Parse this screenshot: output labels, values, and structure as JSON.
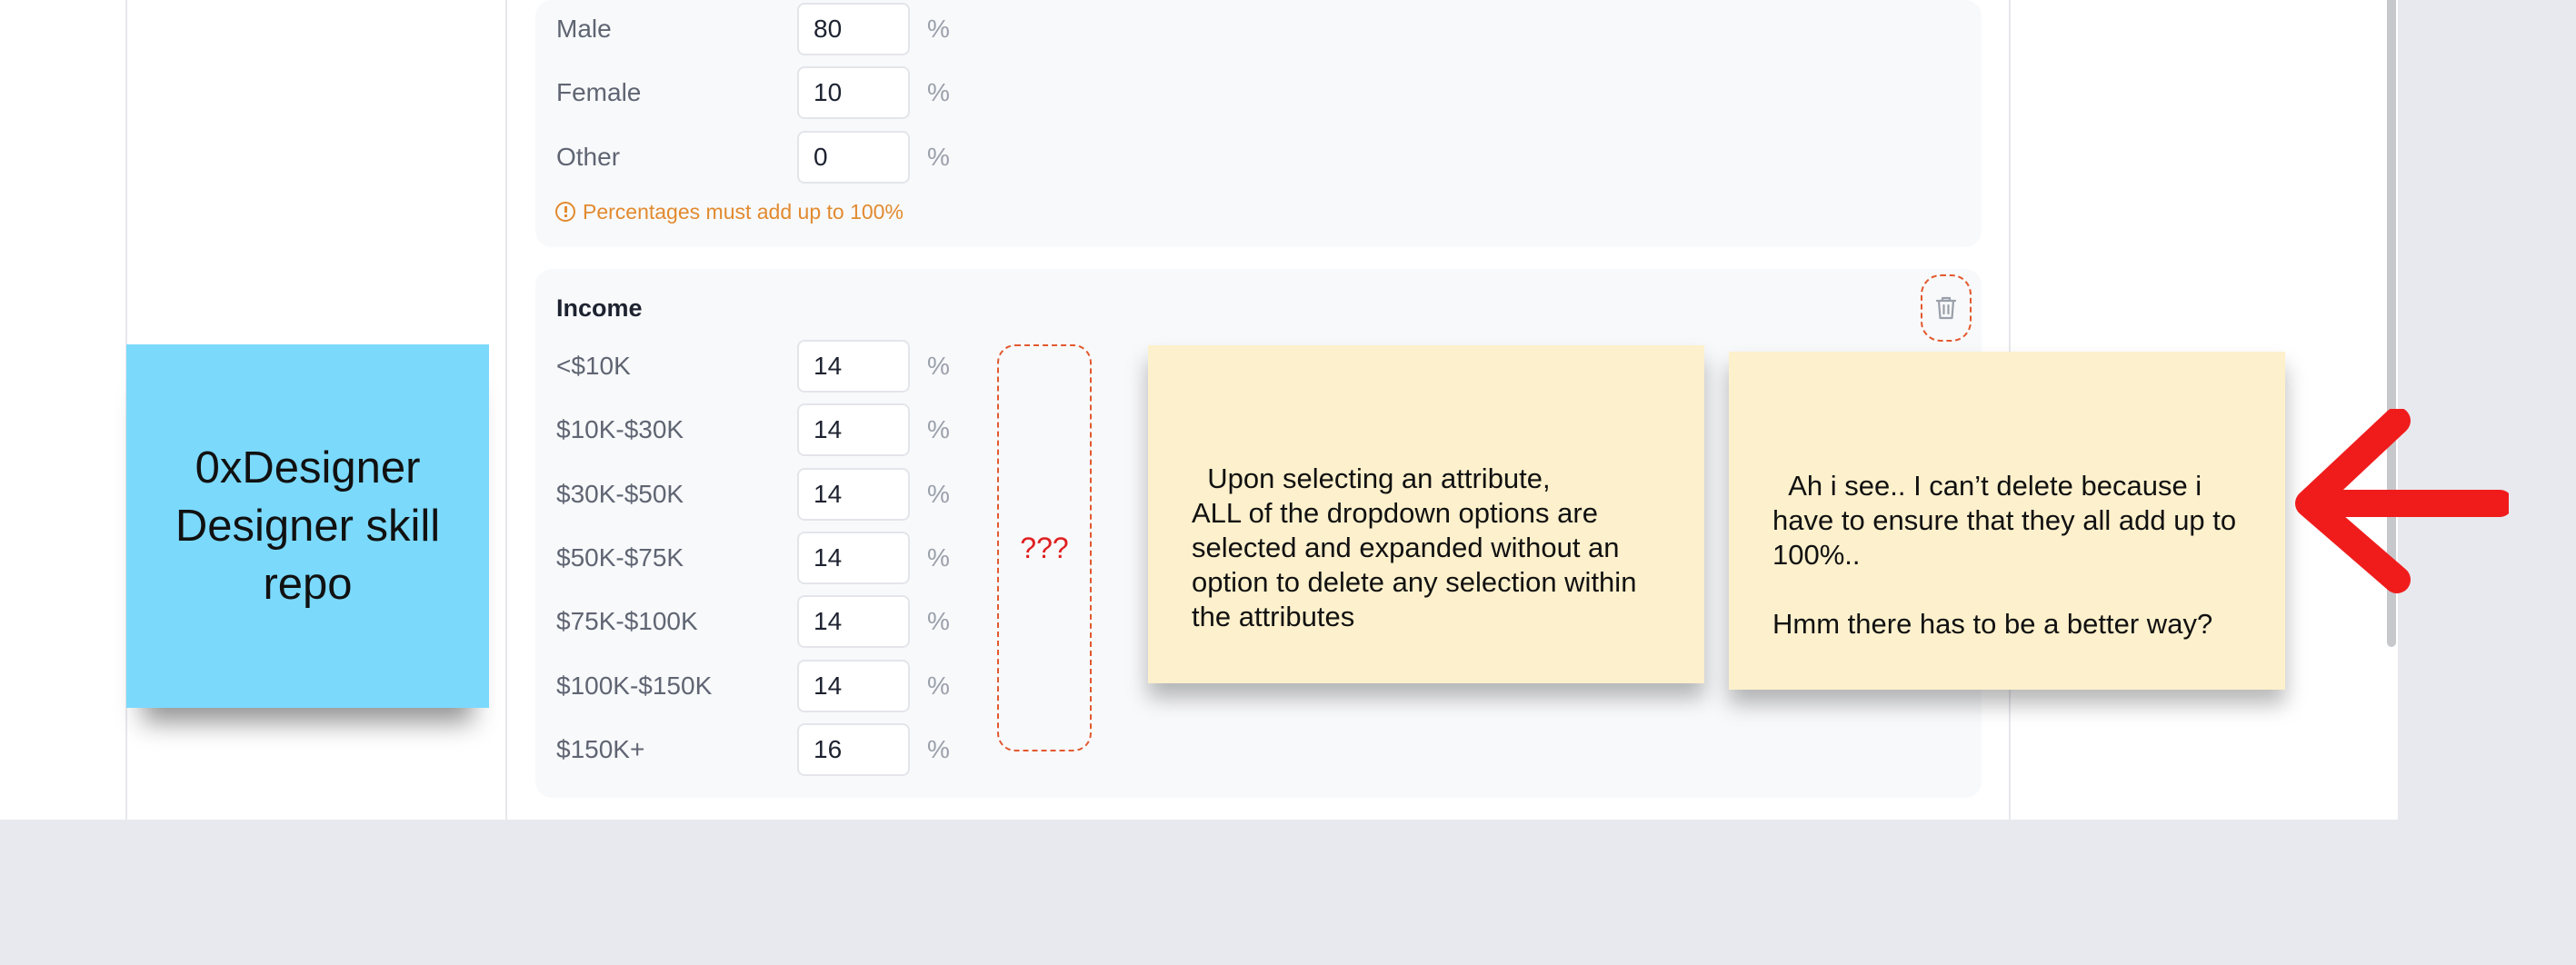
{
  "gender_rows": [
    {
      "label": "Male",
      "value": "80",
      "unit": "%"
    },
    {
      "label": "Female",
      "value": "10",
      "unit": "%"
    },
    {
      "label": "Other",
      "value": "0",
      "unit": "%"
    }
  ],
  "gender_warning": "Percentages must add up to 100%",
  "income": {
    "title": "Income",
    "rows": [
      {
        "label": "<$10K",
        "value": "14",
        "unit": "%"
      },
      {
        "label": "$10K-$30K",
        "value": "14",
        "unit": "%"
      },
      {
        "label": "$30K-$50K",
        "value": "14",
        "unit": "%"
      },
      {
        "label": "$50K-$75K",
        "value": "14",
        "unit": "%"
      },
      {
        "label": "$75K-$100K",
        "value": "14",
        "unit": "%"
      },
      {
        "label": "$100K-$150K",
        "value": "14",
        "unit": "%"
      },
      {
        "label": "$150K+",
        "value": "16",
        "unit": "%"
      }
    ]
  },
  "annotation_marker": "???",
  "sticky_blue": "0xDesigner\nDesigner skill\nrepo",
  "sticky_note_1": "Upon selecting an attribute,\nALL of the dropdown options are selected and expanded without an option to delete any selection within the attributes",
  "sticky_note_2": "Ah i see.. I can’t delete because i have to ensure that they all add up to 100%..\n\nHmm there has to be a better way?",
  "icons": {
    "delete": "trash-icon",
    "warning": "alert-circle-icon",
    "pointer": "arrow-left-icon"
  },
  "colors": {
    "warning": "#e28a2f",
    "annotation": "#e2592f",
    "arrow": "#f01c1c",
    "sticky_yellow": "#fdf0cc",
    "sticky_blue": "#7bd9fc"
  }
}
